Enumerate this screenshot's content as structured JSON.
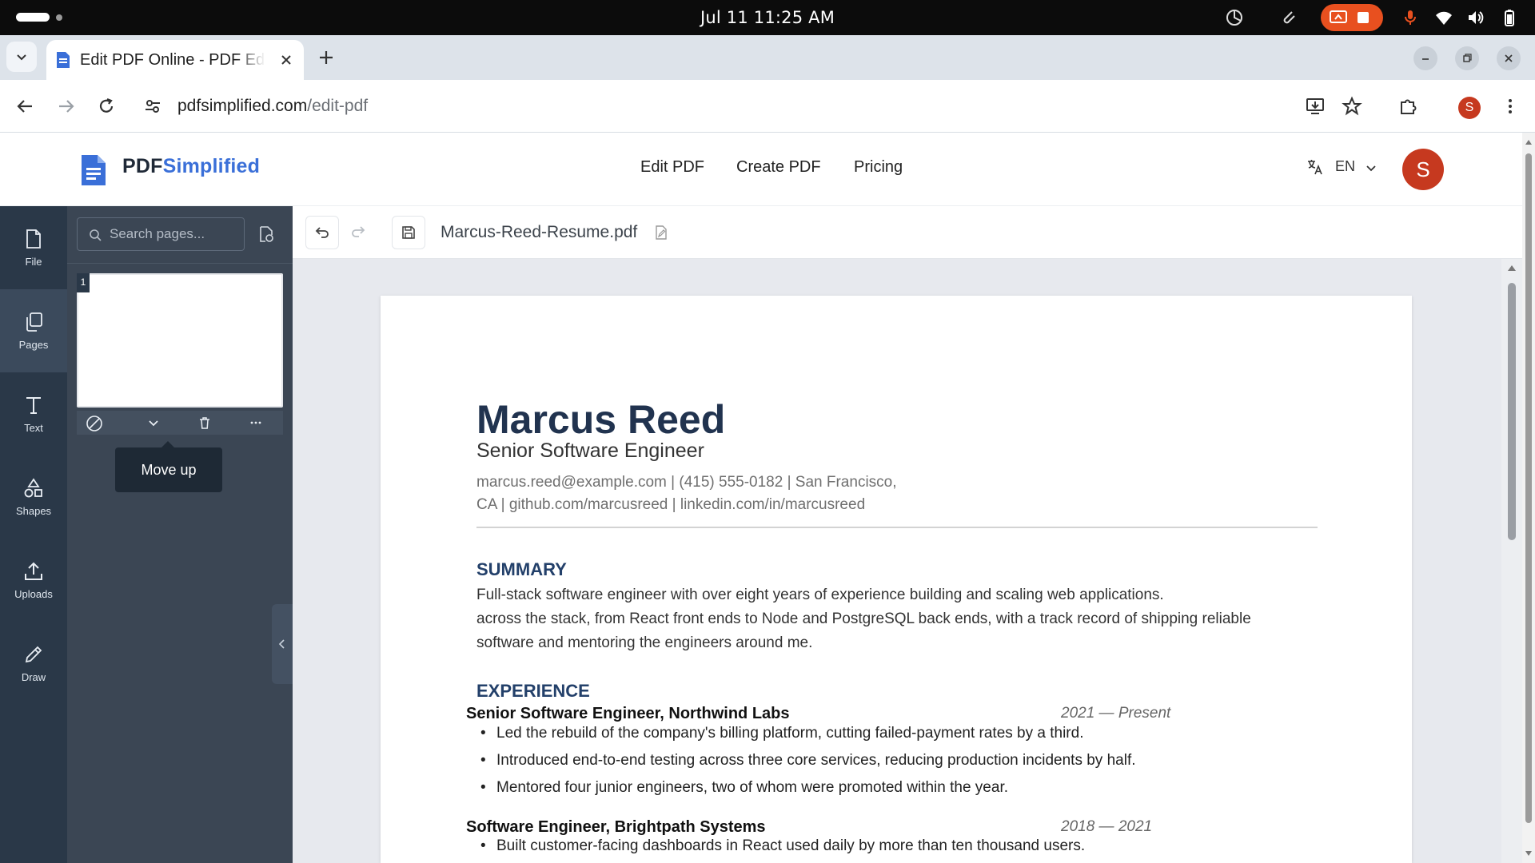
{
  "os": {
    "clock": "Jul 11  11:25 AM"
  },
  "browser": {
    "tab_title": "Edit PDF Online - PDF Editor",
    "url_domain": "pdfsimplified.com",
    "url_path": "/edit-pdf",
    "profile_initial": "S"
  },
  "site": {
    "logo_prefix": "PDF",
    "logo_accent": "Simplified",
    "nav": [
      "Edit PDF",
      "Create PDF",
      "Pricing"
    ],
    "language": "EN",
    "avatar_initial": "S"
  },
  "rail": [
    {
      "label": "File",
      "icon": "file-icon"
    },
    {
      "label": "Pages",
      "icon": "pages-icon"
    },
    {
      "label": "Text",
      "icon": "text-icon"
    },
    {
      "label": "Shapes",
      "icon": "shapes-icon"
    },
    {
      "label": "Uploads",
      "icon": "upload-icon"
    },
    {
      "label": "Draw",
      "icon": "pencil-icon"
    }
  ],
  "pages_panel": {
    "search_placeholder": "Search pages...",
    "page_number": "1",
    "tooltip": "Move up"
  },
  "doc": {
    "filename": "Marcus-Reed-Resume.pdf"
  },
  "resume": {
    "name": "Marcus Reed",
    "title": "Senior Software Engineer",
    "contact_line1": "marcus.reed@example.com  |  (415) 555-0182  |  San Francisco,",
    "contact_line2": "CA  |  github.com/marcusreed  |  linkedin.com/in/marcusreed",
    "summary_heading": "SUMMARY",
    "summary_l1": "Full-stack software engineer with over eight years of experience building and scaling web applications.",
    "summary_l2": "across the stack, from React front ends to Node and PostgreSQL back ends, with a track record of shipping reliable",
    "summary_l3": "software and mentoring the engineers around me.",
    "experience_heading": "EXPERIENCE",
    "jobs": [
      {
        "title": "Senior Software Engineer, Northwind Labs",
        "dates": "2021 — Present",
        "bullets": [
          "Led the rebuild of the company's billing platform, cutting failed-payment rates by a third.",
          "Introduced end-to-end testing across three core services, reducing production incidents by half.",
          "Mentored four junior engineers, two of whom were promoted within the year."
        ]
      },
      {
        "title": "Software Engineer, Brightpath Systems",
        "dates": "2018 — 2021",
        "bullets": [
          "Built customer-facing dashboards in React used daily by more than ten thousand users."
        ]
      }
    ]
  },
  "colors": {
    "accent": "#3a6fd8",
    "avatar": "#c6391f",
    "rail": "#2a3848",
    "heading": "#23406a"
  }
}
